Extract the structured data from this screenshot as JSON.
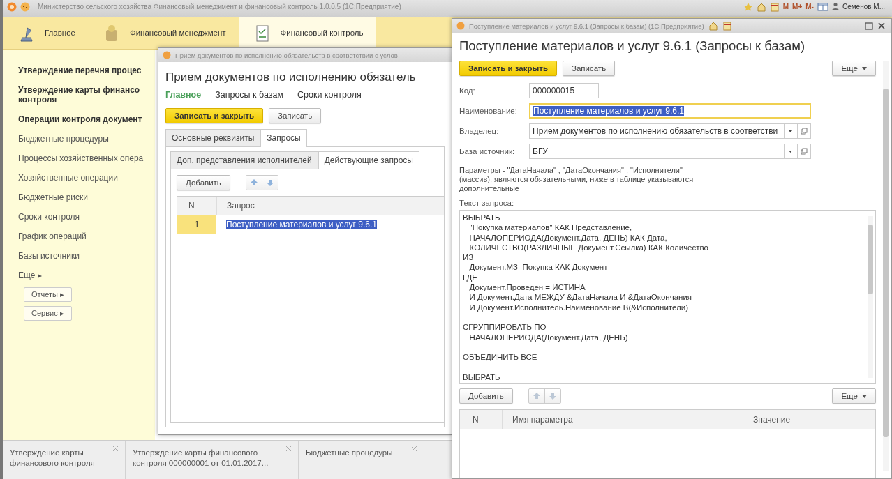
{
  "main_window": {
    "title": "Министерство сельского хозяйства Финансовый менеджмент и финансовый контроль 1.0.0.5 (1С:Предприятие)",
    "title_bar_buttons": [
      "M",
      "M+",
      "M-"
    ],
    "user": "Семенов М...",
    "sections": [
      {
        "label": "Главное",
        "selected": false
      },
      {
        "label": "Финансовый менеджмент",
        "selected": false
      },
      {
        "label": "Финансовый контроль",
        "selected": true
      }
    ],
    "sidebar": [
      {
        "kind": "bold",
        "text": "Утверждение перечня процес"
      },
      {
        "kind": "bold",
        "text": "Утверждение карты финансо контроля"
      },
      {
        "kind": "bold",
        "text": "Операции контроля документ"
      },
      {
        "kind": "link",
        "text": "Бюджетные процедуры"
      },
      {
        "kind": "link",
        "text": "Процессы хозяйственных опера"
      },
      {
        "kind": "link",
        "text": "Хозяйственные операции"
      },
      {
        "kind": "link",
        "text": "Бюджетные риски"
      },
      {
        "kind": "link",
        "text": "Сроки контроля"
      },
      {
        "kind": "link",
        "text": "График операций"
      },
      {
        "kind": "link",
        "text": "Базы источники"
      },
      {
        "kind": "more",
        "text": "Еще ▸"
      },
      {
        "kind": "button",
        "text": "Отчеты ▸"
      },
      {
        "kind": "button",
        "text": "Сервис ▸"
      }
    ],
    "open_tabs": [
      "Утверждение карты финансового контроля",
      "Утверждение карты финансового контроля 000000001 от 01.01.2017...",
      "Бюджетные процедуры"
    ]
  },
  "documents_window": {
    "title": "Прием документов по исполнению обязательств в соответствии с услов",
    "heading": "Прием документов по исполнению обязатель",
    "nav": [
      {
        "label": "Главное",
        "selected": true
      },
      {
        "label": "Запросы к базам",
        "selected": false
      },
      {
        "label": "Сроки контроля",
        "selected": false
      }
    ],
    "buttons": [
      {
        "label": "Записать и закрыть",
        "kind": "primary"
      },
      {
        "label": "Записать",
        "kind": "default"
      }
    ],
    "tabs": [
      {
        "label": "Основные реквизиты",
        "selected": false
      },
      {
        "label": "Запросы",
        "selected": true
      }
    ],
    "subtabs": [
      {
        "label": "Доп. представления исполнителей",
        "selected": false
      },
      {
        "label": "Действующие запросы",
        "selected": true
      }
    ],
    "add_button": "Добавить",
    "table": {
      "columns": [
        "N",
        "Запрос"
      ],
      "rows": [
        {
          "n": "1",
          "query": "Поступление материалов и услуг 9.6.1",
          "selected": true
        }
      ]
    }
  },
  "query_window": {
    "title": "Поступление материалов и услуг 9.6.1 (Запросы к базам)  (1С:Предприятие)",
    "heading": "Поступление материалов и услуг 9.6.1 (Запросы к базам)",
    "buttons": [
      {
        "label": "Записать и закрыть",
        "kind": "primary"
      },
      {
        "label": "Записать",
        "kind": "default"
      }
    ],
    "more_button": "Еще",
    "fields": [
      {
        "label": "Код:",
        "value": "000000015",
        "kind": "short",
        "focused": false
      },
      {
        "label": "Наименование:",
        "value": "Поступление материалов и услуг 9.6.1",
        "kind": "text",
        "focused": true
      },
      {
        "label": "Владелец:",
        "value": "Прием документов по исполнению обязательств в соответстви",
        "kind": "choice",
        "focused": false
      },
      {
        "label": "База источник:",
        "value": "БГУ",
        "kind": "choice",
        "focused": false
      }
    ],
    "note": "Параметры - \"ДатаНачала\" , \"ДатаОкончания\" , \"Исполнители\" (массив), являются обязательными, ниже в таблице указываются дополнительные",
    "query_label": "Текст запроса:",
    "query_text": "ВЫБРАТЬ\n   \"Покупка материалов\" КАК Представление,\n   НАЧАЛОПЕРИОДА(Документ.Дата, ДЕНЬ) КАК Дата,\n   КОЛИЧЕСТВО(РАЗЛИЧНЫЕ Документ.Ссылка) КАК Количество\nИЗ\n   Документ.МЗ_Покупка КАК Документ\nГДЕ\n   Документ.Проведен = ИСТИНА\n   И Документ.Дата МЕЖДУ &ДатаНачала И &ДатаОкончания\n   И Документ.Исполнитель.Наименование В(&Исполнители)\n\nСГРУППИРОВАТЬ ПО\n   НАЧАЛОПЕРИОДА(Документ.Дата, ДЕНЬ)\n\nОБЪЕДИНИТЬ ВСЕ\n\nВЫБРАТЬ",
    "add_button": "Добавить",
    "params_more_button": "Еще",
    "params_table": {
      "columns": [
        "N",
        "Имя параметра",
        "Значение"
      ]
    }
  }
}
